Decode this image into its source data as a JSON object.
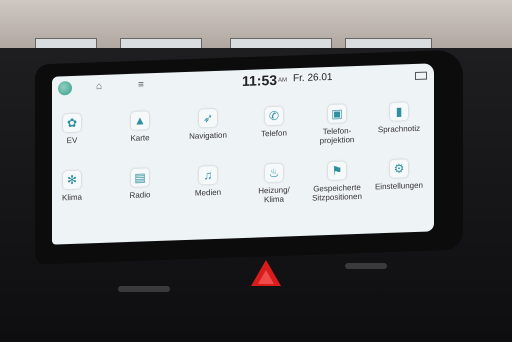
{
  "status": {
    "time": "11:53",
    "ampm": "AM",
    "date": "Fr. 26.01"
  },
  "row1": [
    {
      "label": "EV",
      "icon": "plant-icon",
      "glyph": "✿"
    },
    {
      "label": "Karte",
      "icon": "arrow-icon",
      "glyph": "▲"
    },
    {
      "label": "Navigation",
      "icon": "compass-icon",
      "glyph": "➶"
    },
    {
      "label": "Telefon",
      "icon": "phone-icon",
      "glyph": "✆"
    },
    {
      "label": "Telefon-\nprojektion",
      "icon": "phone-projection-icon",
      "glyph": "▣"
    },
    {
      "label": "Sprachnotiz",
      "icon": "voice-memo-icon",
      "glyph": "▮"
    }
  ],
  "row2": [
    {
      "label": "Klima",
      "icon": "fan-icon",
      "glyph": "✻"
    },
    {
      "label": "Radio",
      "icon": "radio-icon",
      "glyph": "▤"
    },
    {
      "label": "Medien",
      "icon": "music-icon",
      "glyph": "♫"
    },
    {
      "label": "Heizung/\nKlima",
      "icon": "seat-heating-icon",
      "glyph": "♨"
    },
    {
      "label": "Gespeicherte\nSitzpositionen",
      "icon": "seat-position-icon",
      "glyph": "⚑"
    },
    {
      "label": "Einstellungen",
      "icon": "gear-icon",
      "glyph": "⚙"
    }
  ]
}
